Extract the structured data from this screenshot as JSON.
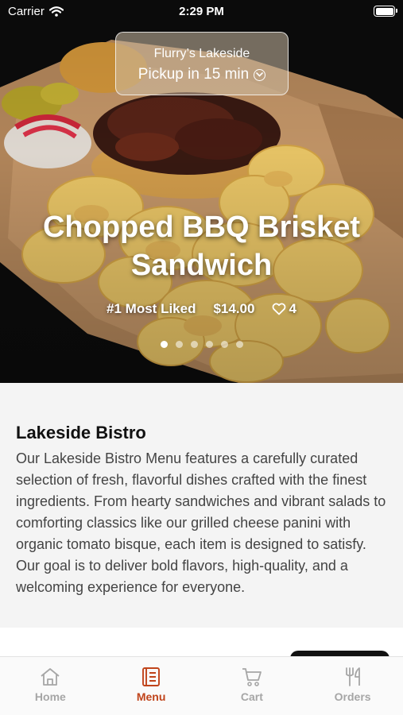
{
  "status_bar": {
    "carrier": "Carrier",
    "time": "2:29 PM"
  },
  "pickup": {
    "location": "Flurry’s Lakeside",
    "eta": "Pickup in 15 min"
  },
  "dish": {
    "title": "Chopped BBQ Brisket Sandwich",
    "badge": "#1 Most Liked",
    "price": "$14.00",
    "likes": "4"
  },
  "carousel": {
    "count": 6,
    "active": 1
  },
  "restaurant": {
    "name": "Lakeside Bistro",
    "description": "Our Lakeside Bistro Menu features a carefully curated selection of fresh, flavorful dishes crafted with the finest ingredients. From hearty sandwiches and vibrant salads to comforting classics like our grilled cheese panini with organic tomato bisque, each item is designed to satisfy. Our goal is to deliver bold flavors, high-quality, and a welcoming experience for everyone."
  },
  "tabs": [
    {
      "label": "Home",
      "icon": "home-icon"
    },
    {
      "label": "Menu",
      "icon": "menu-icon",
      "active": true
    },
    {
      "label": "Cart",
      "icon": "cart-icon"
    },
    {
      "label": "Orders",
      "icon": "orders-icon"
    }
  ],
  "colors": {
    "accent": "#c0441b",
    "inactive_tab": "#a6a6a6"
  }
}
